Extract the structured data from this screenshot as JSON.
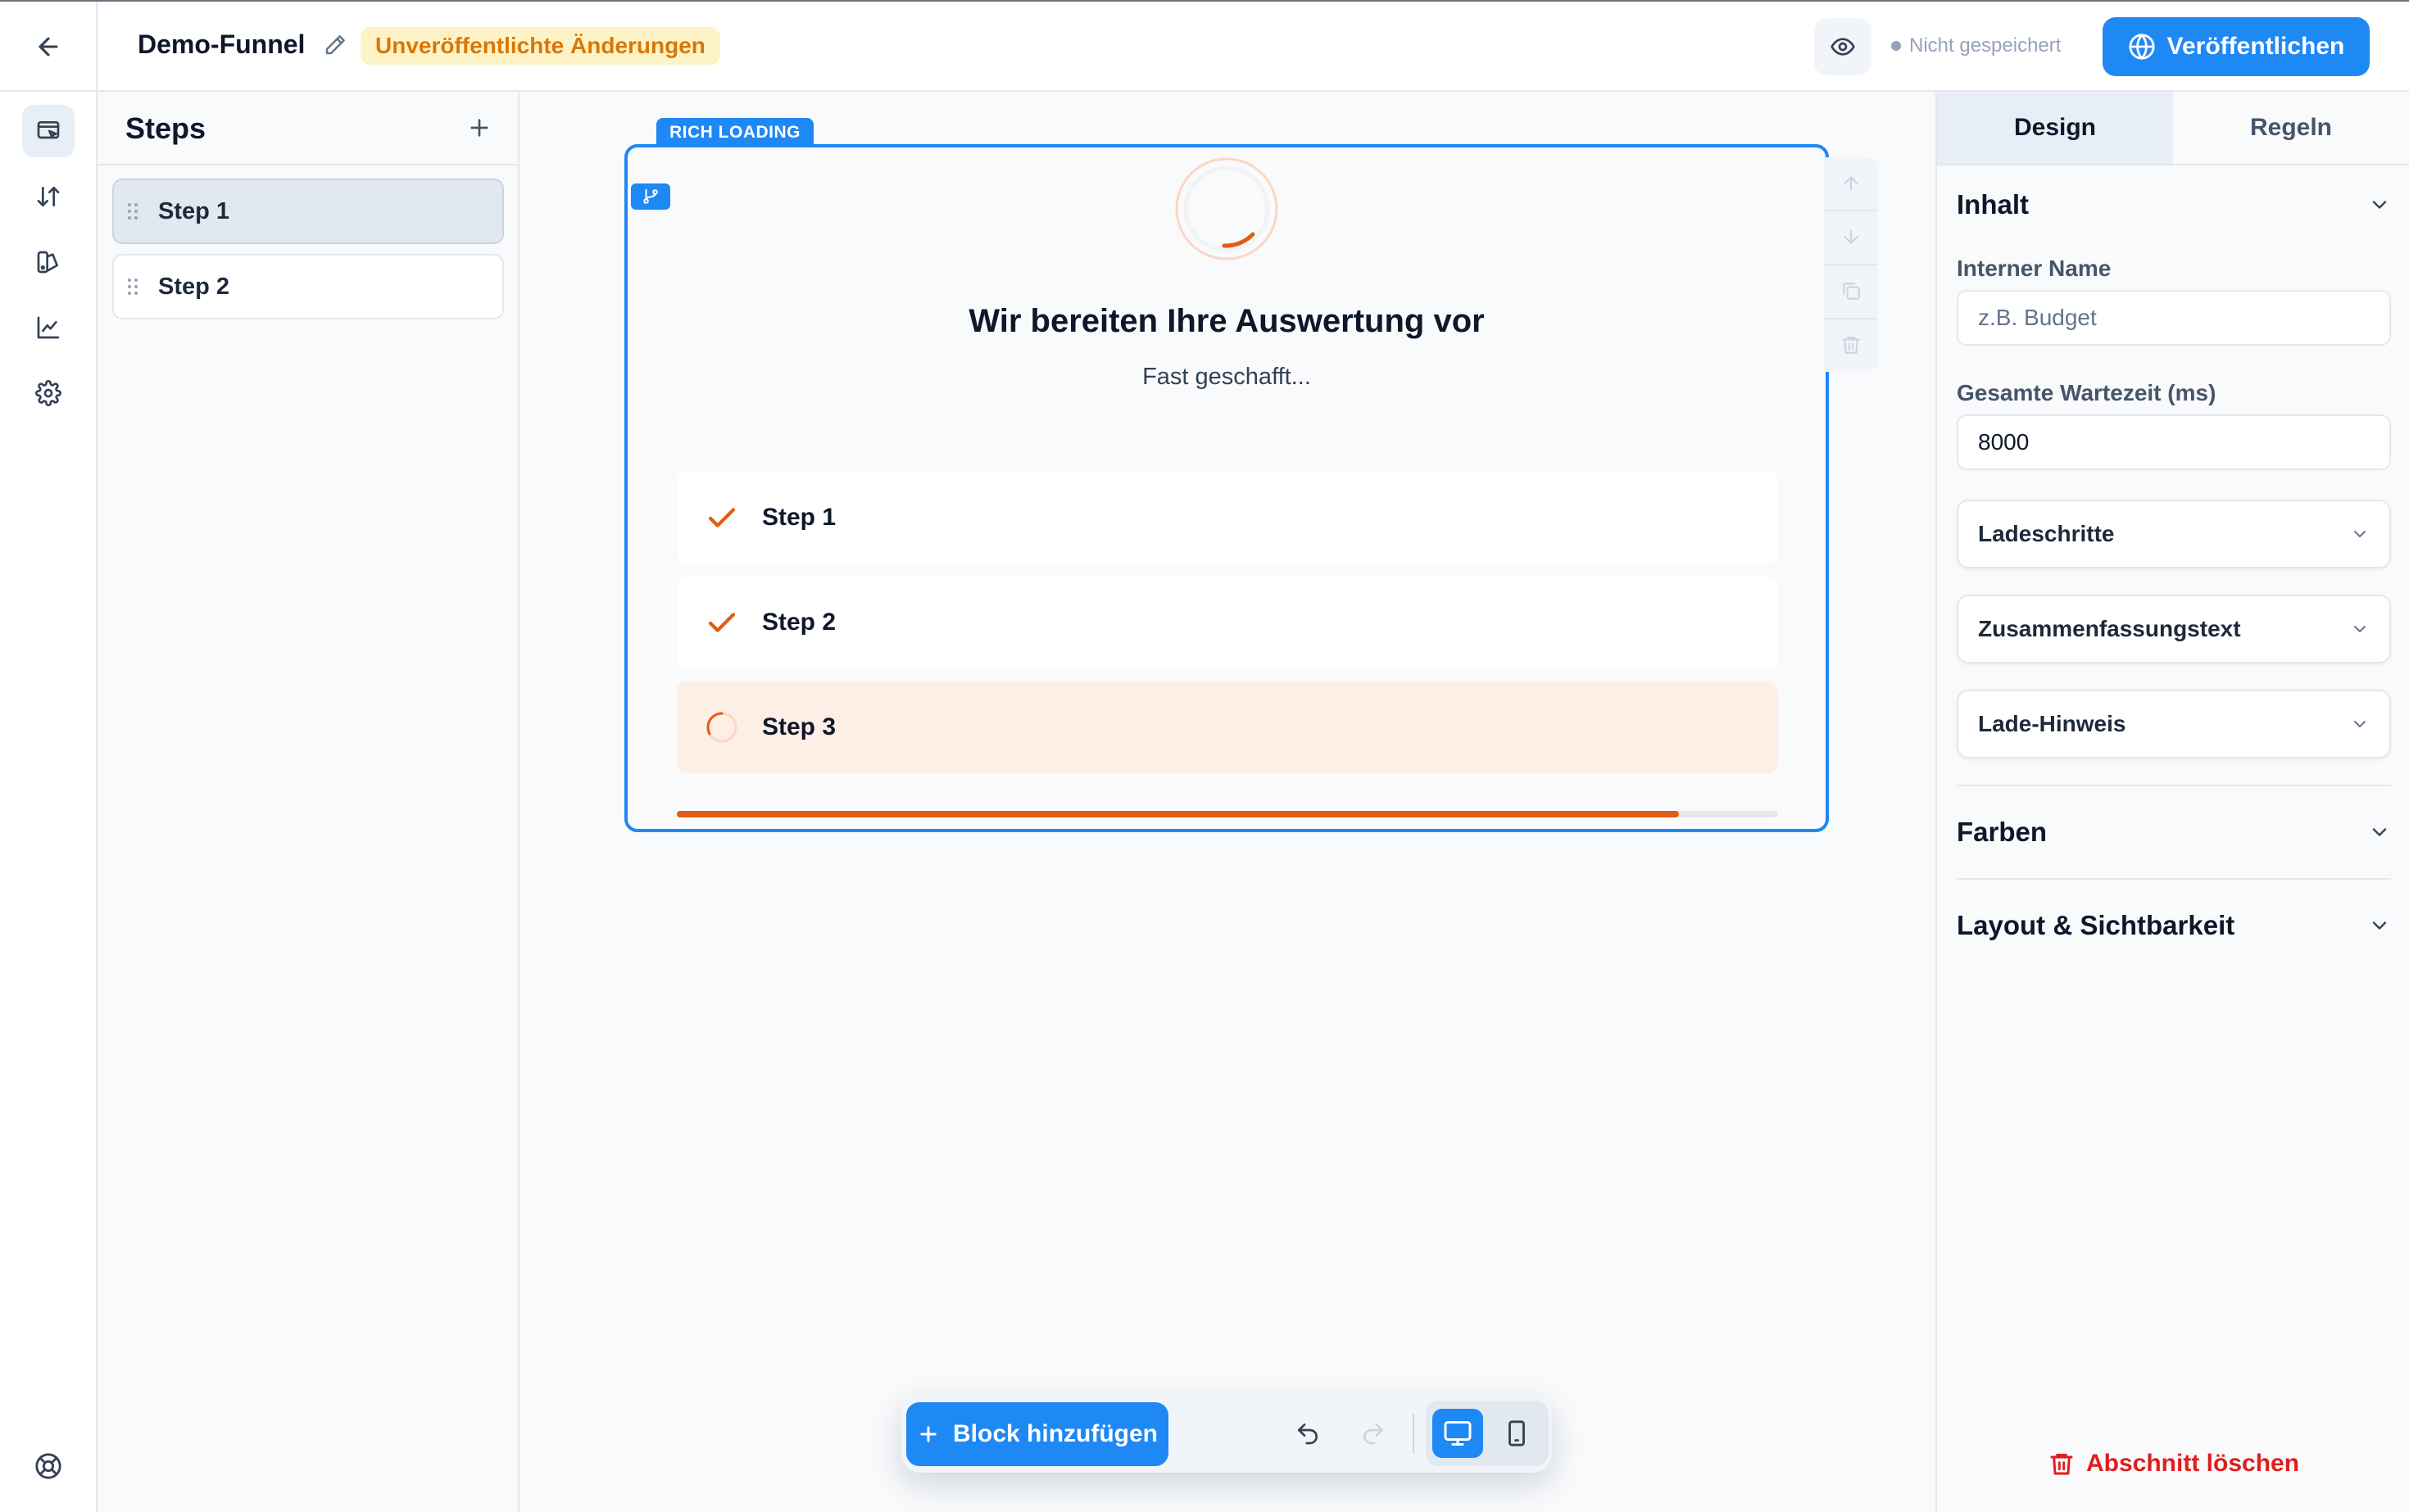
{
  "topbar": {
    "funnel_name": "Demo-Funnel",
    "unpublished_badge": "Unveröffentlichte Änderungen",
    "save_status": "Nicht gespeichert",
    "publish_label": "Veröffentlichen"
  },
  "steps_panel": {
    "title": "Steps",
    "items": [
      {
        "label": "Step 1",
        "active": true
      },
      {
        "label": "Step 2",
        "active": false
      }
    ]
  },
  "block": {
    "tag": "RICH LOADING",
    "title": "Wir bereiten Ihre Auswertung vor",
    "subtitle": "Fast geschafft...",
    "steps": [
      {
        "label": "Step 1",
        "state": "done"
      },
      {
        "label": "Step 2",
        "state": "done"
      },
      {
        "label": "Step 3",
        "state": "loading"
      }
    ],
    "progress": 0.91
  },
  "toolbar": {
    "add_block_label": "Block hinzufügen"
  },
  "right_panel": {
    "tabs": [
      {
        "label": "Design",
        "active": true
      },
      {
        "label": "Regeln",
        "active": false
      }
    ],
    "content_section": "Inhalt",
    "internal_name_label": "Interner Name",
    "internal_name_placeholder": "z.B. Budget",
    "internal_name_value": "",
    "wait_time_label": "Gesamte Wartezeit (ms)",
    "wait_time_value": "8000",
    "accordions": [
      "Ladeschritte",
      "Zusammenfassungstext",
      "Lade-Hinweis"
    ],
    "colors_section": "Farben",
    "layout_section": "Layout & Sichtbarkeit",
    "delete_label": "Abschnitt löschen"
  },
  "colors": {
    "accent": "#1e88f5",
    "loading_orange": "#e25c14",
    "badge_bg": "#fef3c7",
    "badge_text": "#d97706",
    "danger": "#e11d1d"
  }
}
